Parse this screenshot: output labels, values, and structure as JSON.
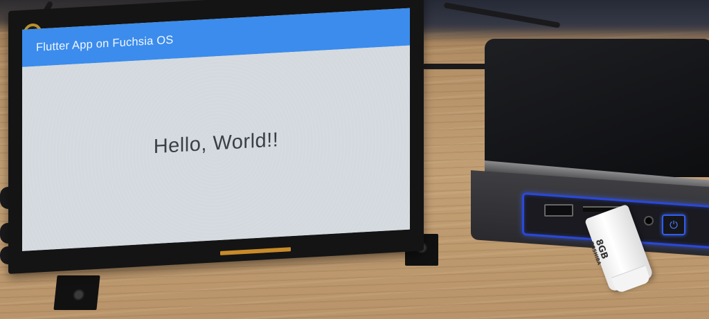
{
  "app": {
    "title": "Flutter App on Fuchsia OS",
    "message": "Hello, World!!",
    "accent_color": "#3b8cec",
    "background_color": "#d3d9de"
  },
  "usb_drive": {
    "capacity": "8GB",
    "brand": "TOSHIBA"
  },
  "mini_pc": {
    "power_icon": "power-icon",
    "led_color": "#2b48d8"
  }
}
